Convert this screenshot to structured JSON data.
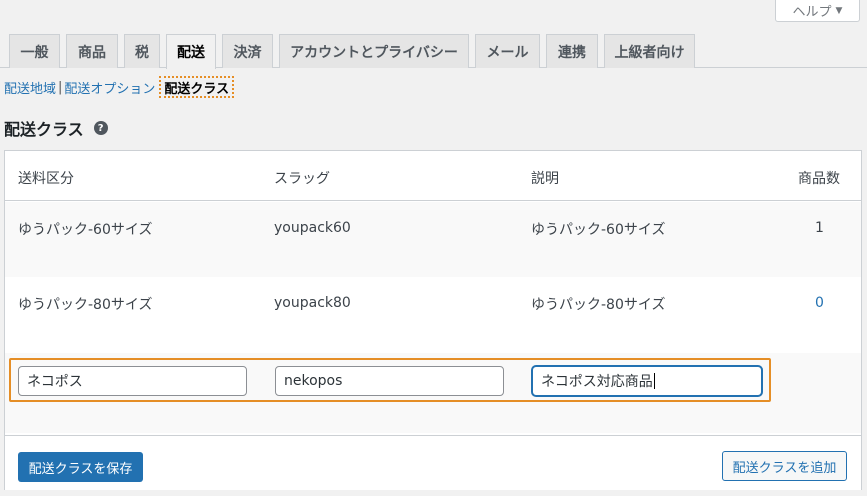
{
  "help": {
    "label": "ヘルプ",
    "arrow": "▼"
  },
  "tabs": [
    {
      "label": "一般"
    },
    {
      "label": "商品"
    },
    {
      "label": "税"
    },
    {
      "label": "配送",
      "active": true
    },
    {
      "label": "決済"
    },
    {
      "label": "アカウントとプライバシー"
    },
    {
      "label": "メール"
    },
    {
      "label": "連携"
    },
    {
      "label": "上級者向け"
    }
  ],
  "subnav": {
    "zones": "配送地域",
    "separator": "|",
    "options": "配送オプション",
    "classes": "配送クラス"
  },
  "section": {
    "title": "配送クラス",
    "help_icon": "?"
  },
  "table": {
    "headers": {
      "name": "送料区分",
      "slug": "スラッグ",
      "description": "説明",
      "count": "商品数"
    },
    "rows": [
      {
        "name": "ゆうパック-60サイズ",
        "slug": "youpack60",
        "description": "ゆうパック-60サイズ",
        "count": "1"
      },
      {
        "name": "ゆうパック-80サイズ",
        "slug": "youpack80",
        "description": "ゆうパック-80サイズ",
        "count": "0"
      }
    ],
    "new_row": {
      "name": "ネコポス",
      "slug": "nekopos",
      "description": "ネコポス対応商品"
    }
  },
  "footer": {
    "save_label": "配送クラスを保存",
    "add_label": "配送クラスを追加"
  },
  "colors": {
    "primary": "#2271b1",
    "highlight": "#e58e26"
  }
}
